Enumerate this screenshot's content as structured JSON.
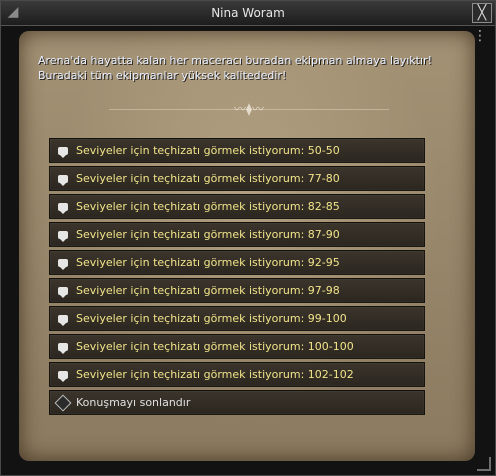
{
  "window": {
    "title": "Nina Woram",
    "close_label": "╳",
    "corner_label": "◢",
    "menu_label": "⋮",
    "divider_ornament": "〰⧫〰"
  },
  "dialog": {
    "line1": "Arena'da hayatta kalan her maceracı buradan ekipman almaya layıktır!",
    "line2": "Buradaki tüm ekipmanlar yüksek kalitededir!"
  },
  "options": [
    "Seviyeler için teçhizatı görmek istiyorum: 50-50",
    "Seviyeler için teçhizatı görmek istiyorum: 77-80",
    "Seviyeler için teçhizatı görmek istiyorum: 82-85",
    "Seviyeler için teçhizatı görmek istiyorum: 87-90",
    "Seviyeler için teçhizatı görmek istiyorum: 92-95",
    "Seviyeler için teçhizatı görmek istiyorum: 97-98",
    "Seviyeler için teçhizatı görmek istiyorum: 99-100",
    "Seviyeler için teçhizatı görmek istiyorum: 100-100",
    "Seviyeler için teçhizatı görmek istiyorum: 102-102"
  ],
  "end": {
    "label": "Konuşmayı sonlandır"
  },
  "colors": {
    "option_text": "#f2e48a",
    "parchment": "#a49275",
    "panel": "#2b261f"
  },
  "icons": {
    "option": "chat-bubble-icon",
    "end": "diamond-icon",
    "close": "close-icon"
  }
}
